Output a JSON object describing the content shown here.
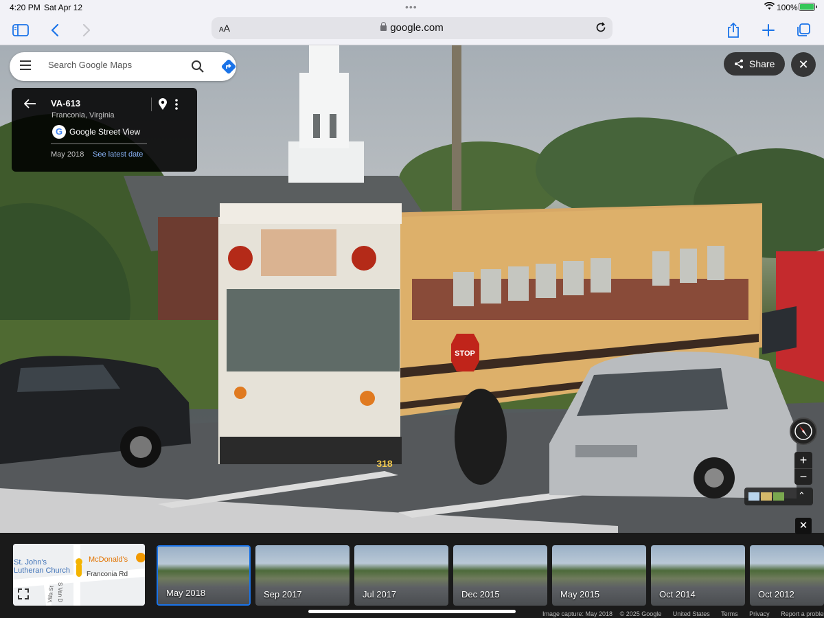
{
  "status_bar": {
    "time": "4:20 PM",
    "date": "Sat Apr 12",
    "battery": "100%"
  },
  "browser": {
    "url": "google.com",
    "text_size_label": "AA"
  },
  "search": {
    "placeholder": "Search Google Maps"
  },
  "info_card": {
    "title": "VA-613",
    "subtitle": "Franconia, Virginia",
    "source": "Google Street View",
    "capture_date": "May 2018",
    "latest_link": "See latest date"
  },
  "controls": {
    "share_label": "Share",
    "close_symbol": "✕",
    "zoom_in": "+",
    "zoom_out": "−"
  },
  "minimap": {
    "labels": [
      "St. John's",
      "Lutheran Church",
      "McDonald's",
      "Franconia Rd",
      "Villa St",
      "S Van D"
    ]
  },
  "timeline": [
    {
      "label": "May 2018",
      "selected": true
    },
    {
      "label": "Sep 2017",
      "selected": false
    },
    {
      "label": "Jul 2017",
      "selected": false
    },
    {
      "label": "Dec 2015",
      "selected": false
    },
    {
      "label": "May 2015",
      "selected": false
    },
    {
      "label": "Oct 2014",
      "selected": false
    },
    {
      "label": "Oct 2012",
      "selected": false
    }
  ],
  "scene": {
    "bus_number": "318",
    "stop_sign": "STOP"
  },
  "footer": {
    "capture": "Image capture: May 2018",
    "copyright": "© 2025 Google",
    "region": "United States",
    "terms": "Terms",
    "privacy": "Privacy",
    "report": "Report a problem"
  },
  "colors": {
    "accent": "#1a73e8",
    "bus_yellow": "#e2b46a",
    "card_bg": "#000000"
  },
  "icons": [
    "sidebar-icon",
    "back-icon",
    "forward-icon",
    "reload-icon",
    "share-icon",
    "plus-icon",
    "tabs-icon",
    "menu-icon",
    "search-icon",
    "directions-icon",
    "pin-icon",
    "more-icon",
    "compass-icon",
    "fullscreen-icon"
  ]
}
